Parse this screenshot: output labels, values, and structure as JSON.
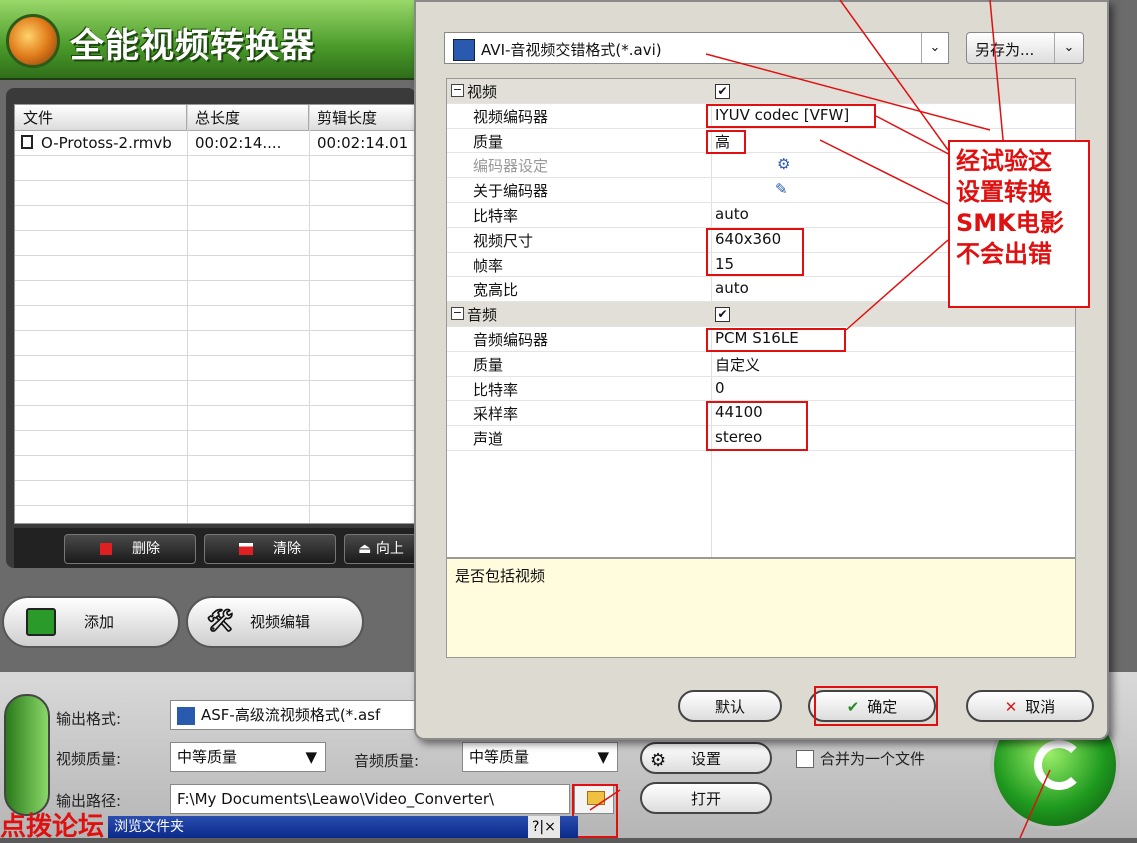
{
  "app": {
    "title": "全能视频转换器",
    "table": {
      "headers": [
        "文件",
        "总长度",
        "剪辑长度"
      ],
      "rows": [
        {
          "file": "O-Protoss-2.rmvb",
          "total": "00:02:14....",
          "clip": "00:02:14.01"
        }
      ]
    },
    "table_buttons": {
      "delete": "删除",
      "clear": "清除",
      "up": "向上"
    },
    "buttons": {
      "add": "添加",
      "video_edit": "视频编辑"
    },
    "output": {
      "format_label": "输出格式:",
      "format_value": "ASF-高级流视频格式(*.asf",
      "video_quality_label": "视频质量:",
      "video_quality_value": "中等质量",
      "audio_quality_label": "音频质量:",
      "audio_quality_value": "中等质量",
      "settings_button": "设置",
      "merge_label": "合并为一个文件",
      "path_label": "输出路径:",
      "path_value": "F:\\My Documents\\Leawo\\Video_Converter\\",
      "open_button": "打开"
    }
  },
  "dialog": {
    "format": "AVI-音视频交错格式(*.avi)",
    "save_as": "另存为...",
    "properties": [
      {
        "name": "视频",
        "value": "✔",
        "group": true
      },
      {
        "name": "视频编码器",
        "value": "IYUV codec [VFW]"
      },
      {
        "name": "质量",
        "value": "高"
      },
      {
        "name": "编码器设定",
        "value": "",
        "disabled": true
      },
      {
        "name": "关于编码器",
        "value": ""
      },
      {
        "name": "比特率",
        "value": "auto"
      },
      {
        "name": "视频尺寸",
        "value": "640x360"
      },
      {
        "name": "帧率",
        "value": "15"
      },
      {
        "name": "宽高比",
        "value": "auto"
      },
      {
        "name": "音频",
        "value": "✔",
        "group": true
      },
      {
        "name": "音频编码器",
        "value": "PCM S16LE"
      },
      {
        "name": "质量",
        "value": "自定义"
      },
      {
        "name": "比特率",
        "value": "0"
      },
      {
        "name": "采样率",
        "value": "44100"
      },
      {
        "name": "声道",
        "value": "stereo"
      }
    ],
    "description": "是否包括视频",
    "default_button": "默认",
    "ok_button": "确定",
    "cancel_button": "取消"
  },
  "annotation": {
    "lines": [
      "经试验这",
      "设置转换",
      "SMK电影",
      "不会出错"
    ]
  },
  "watermark": "点拨论坛",
  "browse_dialog": {
    "title": "浏览文件夹",
    "controls": "?|×"
  },
  "colors": {
    "annotation_red": "#e01010",
    "brand_green": "#2f8a1c"
  }
}
